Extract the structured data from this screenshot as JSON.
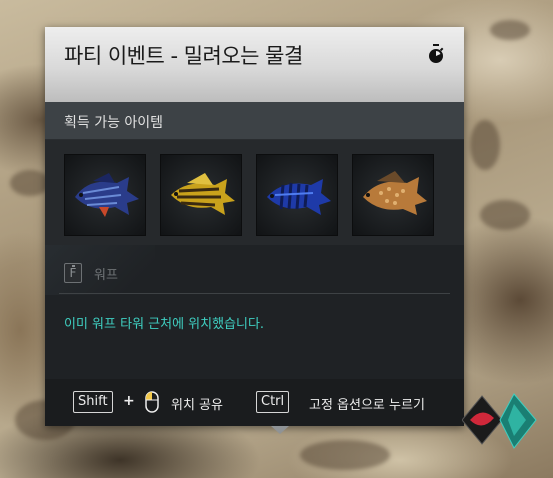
{
  "panel": {
    "title": "파티 이벤트 - 밀려오는 물결",
    "timer_icon": "stopwatch-icon",
    "obtainable_label": "획득 가능 아이템",
    "items": [
      {
        "name": "blue-striped-fish",
        "colors": [
          "#2a3c8a",
          "#6a8bd6",
          "#c8482a"
        ]
      },
      {
        "name": "yellow-striped-fish",
        "colors": [
          "#c9a21c",
          "#3a2a10",
          "#e0c040"
        ]
      },
      {
        "name": "blue-barred-fish",
        "colors": [
          "#1e3aa8",
          "#4f7df0",
          "#0f1c55"
        ]
      },
      {
        "name": "orange-spotted-fish",
        "colors": [
          "#b87a3a",
          "#e0b070",
          "#6a4a2a"
        ]
      }
    ],
    "warp": {
      "key": "F",
      "label": "워프",
      "message": "이미 워프 타워 근처에 위치했습니다."
    },
    "footer": {
      "shift_key": "Shift",
      "plus": "+",
      "share_label": "위치 공유",
      "ctrl_key": "Ctrl",
      "pin_label": "고정 옵션으로 누르기"
    }
  },
  "colors": {
    "accent_text": "#3fcfc1",
    "panel_bg": "#1f2225",
    "header_bg": "#d9d9d9"
  }
}
